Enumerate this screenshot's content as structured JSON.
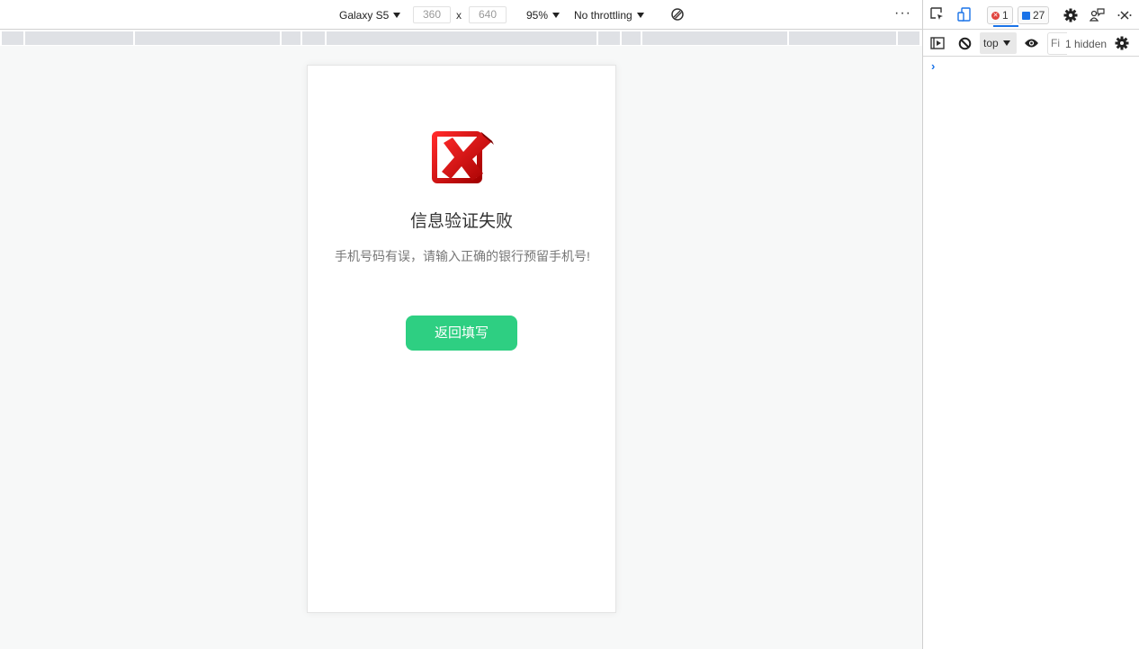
{
  "device_toolbar": {
    "device": "Galaxy S5",
    "width": "360",
    "height": "640",
    "times": "x",
    "zoom": "95%",
    "throttling": "No throttling",
    "rotate_icon": "rotate-icon",
    "more_icon": "more-options-icon"
  },
  "media_query_bar": {
    "segments": 11
  },
  "page": {
    "icon": "failure-cross-icon",
    "title": "信息验证失败",
    "message": "手机号码有误，请输入正确的银行预留手机号!",
    "button": "返回填写",
    "accent_color": "#2ecf82"
  },
  "devtools": {
    "icons": [
      "inspect-element-icon",
      "device-toolbar-icon",
      "settings-icon",
      "feedback-icon",
      "close-icon"
    ],
    "error_count": "1",
    "message_count": "27",
    "console": {
      "context": "top",
      "filter_placeholder": "Fi",
      "hidden": "1 hidden",
      "prompt": "›"
    }
  }
}
